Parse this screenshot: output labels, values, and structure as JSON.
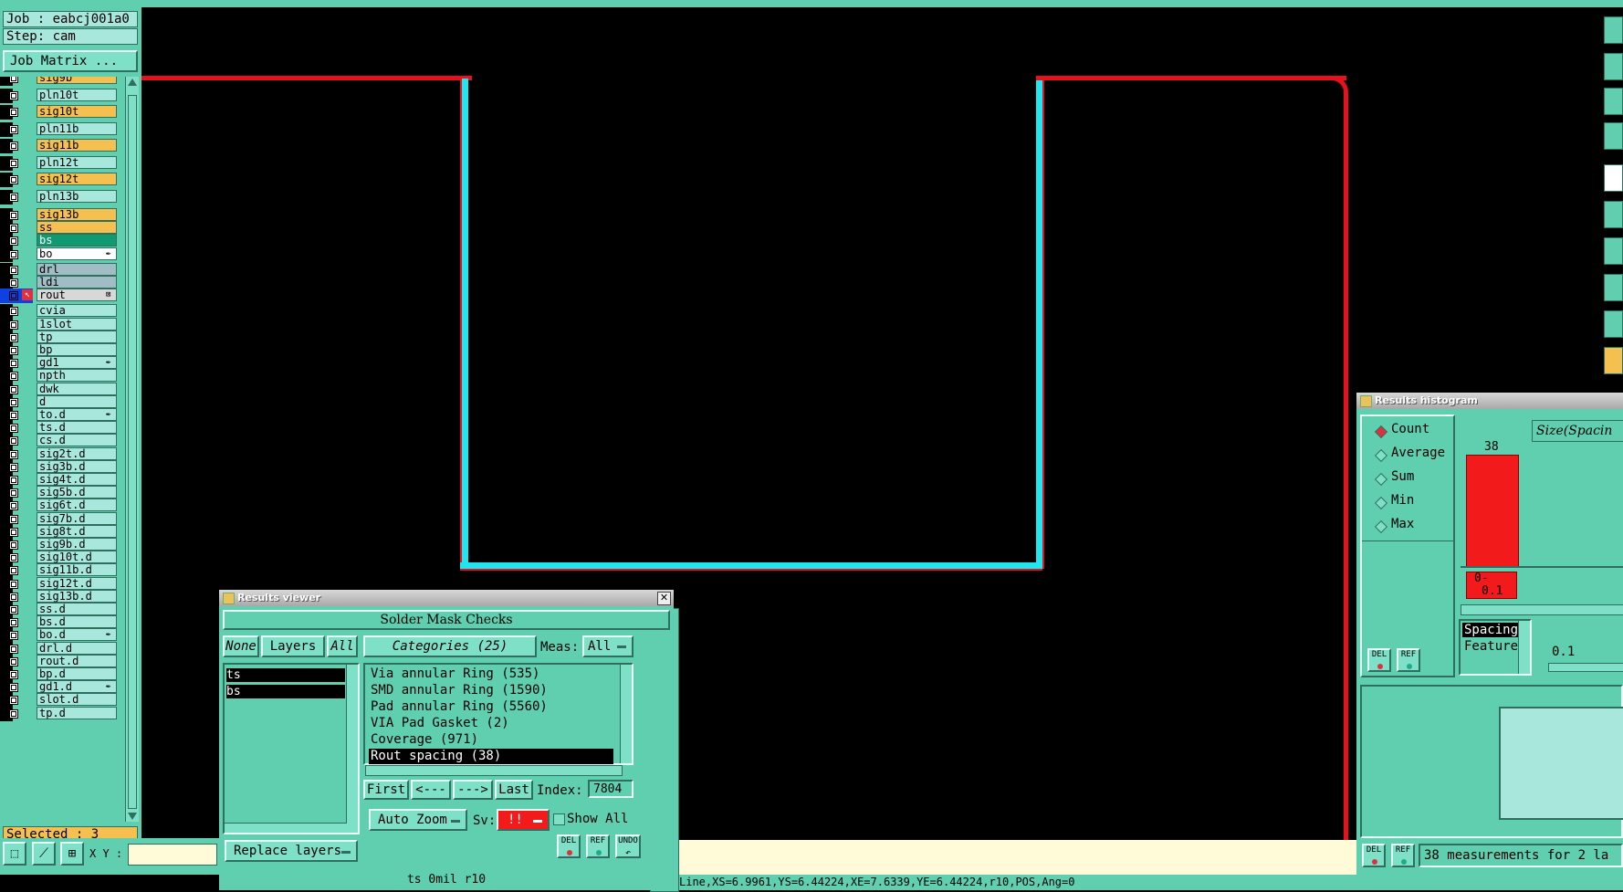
{
  "left_panel": {
    "job": "Job : eabcj001a0",
    "step": "Step: cam",
    "job_matrix": "Job Matrix ...",
    "selected": "Selected : 3",
    "layers": [
      {
        "name": "sig9b",
        "color": "#f6c050",
        "mark": ""
      },
      {
        "name": "pln10t",
        "color": "#a8e8dc",
        "mark": ""
      },
      {
        "name": "sig10t",
        "color": "#f6c050",
        "mark": ""
      },
      {
        "name": "pln11b",
        "color": "#a8e8dc",
        "mark": ""
      },
      {
        "name": "sig11b",
        "color": "#f6c050",
        "mark": ""
      },
      {
        "name": "pln12t",
        "color": "#a8e8dc",
        "mark": ""
      },
      {
        "name": "sig12t",
        "color": "#f6c050",
        "mark": ""
      },
      {
        "name": "pln13b",
        "color": "#a8e8dc",
        "mark": ""
      },
      {
        "name": "sig13b",
        "color": "#f6c050",
        "mark": ""
      },
      {
        "name": "ss",
        "color": "#f6c050",
        "mark": ""
      },
      {
        "name": "bs",
        "color": "#0f9a70",
        "mark": ""
      },
      {
        "name": "bo",
        "color": "#ffffff",
        "mark": "✒"
      },
      {
        "name": "drl",
        "color": "#a0bcc4",
        "mark": ""
      },
      {
        "name": "ldi",
        "color": "#a0bcc4",
        "mark": ""
      },
      {
        "name": "rout",
        "color": "#d8d8d8",
        "mark": "⊠"
      },
      {
        "name": "cvia",
        "color": "#a8e8dc",
        "mark": ""
      },
      {
        "name": "1slot",
        "color": "#a8e8dc",
        "mark": ""
      },
      {
        "name": "tp",
        "color": "#a8e8dc",
        "mark": ""
      },
      {
        "name": "bp",
        "color": "#a8e8dc",
        "mark": ""
      },
      {
        "name": "gd1",
        "color": "#a8e8dc",
        "mark": "✒"
      },
      {
        "name": "npth",
        "color": "#a8e8dc",
        "mark": ""
      },
      {
        "name": "dwk",
        "color": "#a8e8dc",
        "mark": ""
      },
      {
        "name": "d",
        "color": "#a8e8dc",
        "mark": ""
      },
      {
        "name": "to.d",
        "color": "#a8e8dc",
        "mark": "✒"
      },
      {
        "name": "ts.d",
        "color": "#a8e8dc",
        "mark": ""
      },
      {
        "name": "cs.d",
        "color": "#a8e8dc",
        "mark": ""
      },
      {
        "name": "sig2t.d",
        "color": "#a8e8dc",
        "mark": ""
      },
      {
        "name": "sig3b.d",
        "color": "#a8e8dc",
        "mark": ""
      },
      {
        "name": "sig4t.d",
        "color": "#a8e8dc",
        "mark": ""
      },
      {
        "name": "sig5b.d",
        "color": "#a8e8dc",
        "mark": ""
      },
      {
        "name": "sig6t.d",
        "color": "#a8e8dc",
        "mark": ""
      },
      {
        "name": "sig7b.d",
        "color": "#a8e8dc",
        "mark": ""
      },
      {
        "name": "sig8t.d",
        "color": "#a8e8dc",
        "mark": ""
      },
      {
        "name": "sig9b.d",
        "color": "#a8e8dc",
        "mark": ""
      },
      {
        "name": "sig10t.d",
        "color": "#a8e8dc",
        "mark": ""
      },
      {
        "name": "sig11b.d",
        "color": "#a8e8dc",
        "mark": ""
      },
      {
        "name": "sig12t.d",
        "color": "#a8e8dc",
        "mark": ""
      },
      {
        "name": "sig13b.d",
        "color": "#a8e8dc",
        "mark": ""
      },
      {
        "name": "ss.d",
        "color": "#a8e8dc",
        "mark": ""
      },
      {
        "name": "bs.d",
        "color": "#a8e8dc",
        "mark": ""
      },
      {
        "name": "bo.d",
        "color": "#a8e8dc",
        "mark": "✒"
      },
      {
        "name": "drl.d",
        "color": "#a8e8dc",
        "mark": ""
      },
      {
        "name": "rout.d",
        "color": "#a8e8dc",
        "mark": ""
      },
      {
        "name": "bp.d",
        "color": "#a8e8dc",
        "mark": ""
      },
      {
        "name": "gd1.d",
        "color": "#a8e8dc",
        "mark": "✒"
      },
      {
        "name": "slot.d",
        "color": "#a8e8dc",
        "mark": ""
      },
      {
        "name": "tp.d",
        "color": "#a8e8dc",
        "mark": ""
      }
    ]
  },
  "toolbar_bottom": {
    "xy_label": "X Y :"
  },
  "results_viewer": {
    "title": "Results viewer",
    "header": "Solder Mask Checks",
    "none_btn": "None",
    "layers_btn": "Layers",
    "all_btn": "All",
    "categories_btn": "Categories (25)",
    "meas_label": "Meas:",
    "meas_value": "All",
    "layer_list": [
      "ts",
      "bs"
    ],
    "categories": [
      "Via annular Ring (535)",
      "SMD annular Ring (1590)",
      "Pad annular Ring (5560)",
      "VIA Pad Gasket (2)",
      "Coverage (971)",
      "Rout spacing (38)"
    ],
    "first": "First",
    "prev": "<---",
    "next": "--->",
    "last": "Last",
    "index_label": "Index:",
    "index_value": "7804",
    "auto_zoom": "Auto Zoom",
    "sv_label": "Sv:",
    "sv_value": "!!",
    "show_all": "Show All",
    "replace_layers": "Replace layers",
    "del": "DEL",
    "ref": "REF",
    "undo": "UNDO",
    "footer": "ts 0mil  r10"
  },
  "histogram": {
    "title": "Results histogram",
    "options": [
      "Count",
      "Average",
      "Sum",
      "Min",
      "Max"
    ],
    "size_label": "Size(Spacin",
    "bar_count": "38",
    "bin_label_1": "0-",
    "bin_label_2": "0.1",
    "list_items": [
      "Spacing",
      "Feature"
    ],
    "range_value": "0.1",
    "summary": "38 measurements for 2 la",
    "del": "DEL",
    "ref": "REF"
  },
  "status_line": "Line,XS=6.9961,YS=6.44224,XE=7.6339,YE=6.44224,r10,POS,Ang=0",
  "partial_text": "ll"
}
